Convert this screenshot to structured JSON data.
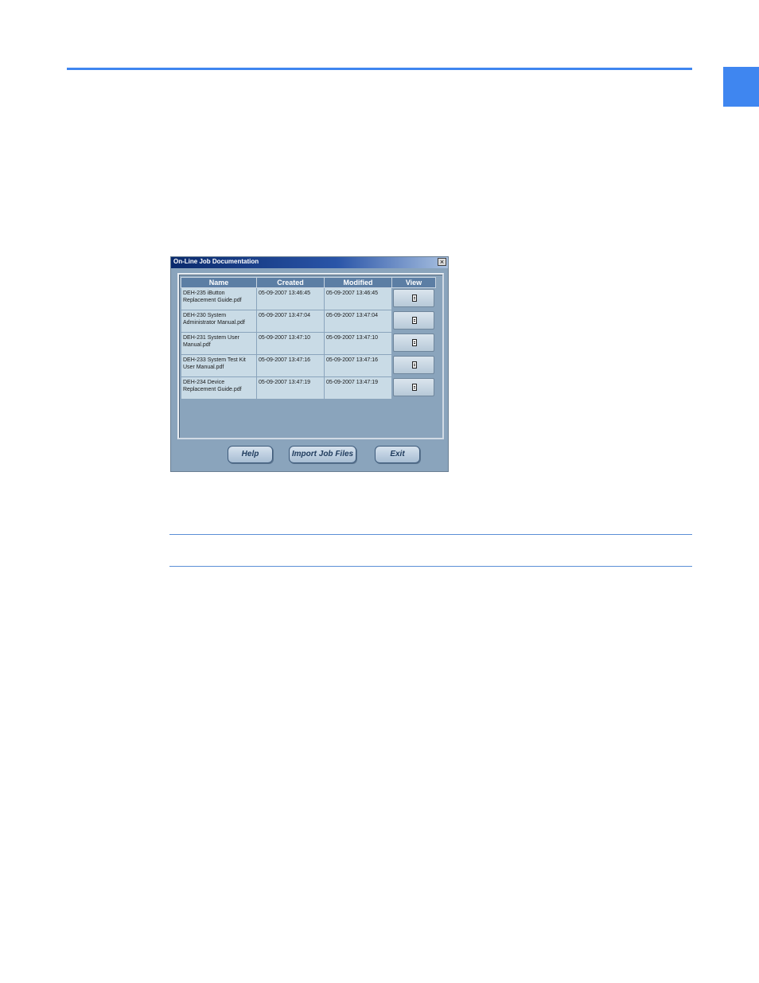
{
  "dialog": {
    "title": "On-Line Job Documentation",
    "close_glyph": "×",
    "columns": [
      "Name",
      "Created",
      "Modified",
      "View"
    ],
    "rows": [
      {
        "name": "DEH-235 iButton Replacement Guide.pdf",
        "created": "05-09-2007 13:46:45",
        "modified": "05-09-2007 13:46:45"
      },
      {
        "name": "DEH-230 System Administrator Manual.pdf",
        "created": "05-09-2007 13:47:04",
        "modified": "05-09-2007 13:47:04"
      },
      {
        "name": "DEH-231 System User Manual.pdf",
        "created": "05-09-2007 13:47:10",
        "modified": "05-09-2007 13:47:10"
      },
      {
        "name": "DEH-233 System Test Kit User Manual.pdf",
        "created": "05-09-2007 13:47:16",
        "modified": "05-09-2007 13:47:16"
      },
      {
        "name": "DEH-234 Device Replacement Guide.pdf",
        "created": "05-09-2007 13:47:19",
        "modified": "05-09-2007 13:47:19"
      }
    ],
    "view_icon": "document-icon",
    "buttons": {
      "help": "Help",
      "import": "Import Job Files",
      "exit": "Exit"
    }
  },
  "colors": {
    "accent": "#3f86f0",
    "dialog_bg": "#8aa4bc",
    "header_bg": "#5c7ea4",
    "cell_bg": "#c9dbe6"
  }
}
